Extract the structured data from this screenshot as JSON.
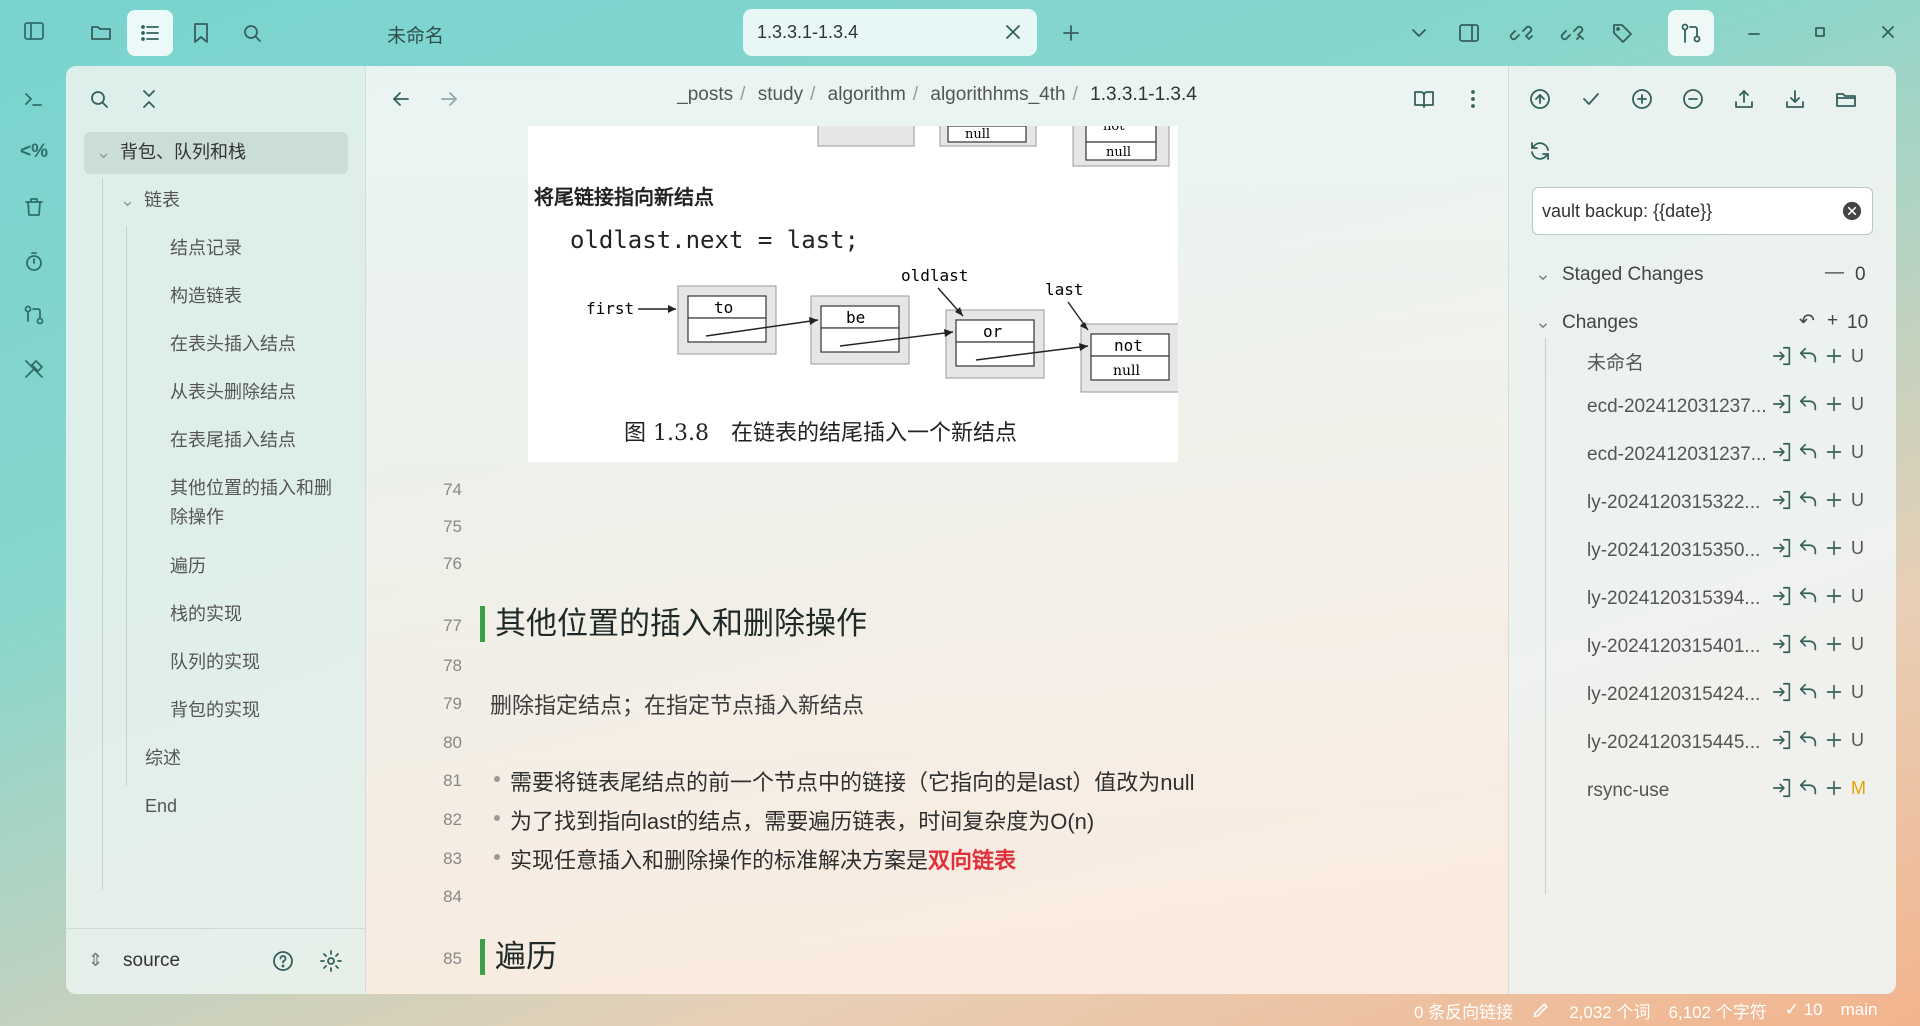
{
  "tabs": {
    "inactive_title": "未命名",
    "active_title": "1.3.3.1-1.3.4"
  },
  "breadcrumb": [
    "_posts",
    "study",
    "algorithm",
    "algorithhms_4th",
    "1.3.3.1-1.3.4"
  ],
  "outline": {
    "root": "背包、队列和栈",
    "group": "链表",
    "items": [
      "结点记录",
      "构造链表",
      "在表头插入结点",
      "从表头删除结点",
      "在表尾插入结点",
      "其他位置的插入和删除操作",
      "遍历",
      "栈的实现",
      "队列的实现",
      "背包的实现"
    ],
    "after": [
      "综述",
      "End"
    ]
  },
  "vault": "source",
  "figure": {
    "subtitle": "将尾链接指向新结点",
    "code": "oldlast.next = last;",
    "labels": {
      "first": "first",
      "oldlast": "oldlast",
      "last": "last"
    },
    "nodes": [
      "to",
      "be",
      "or",
      "not"
    ],
    "null": "null",
    "caption": "图 1.3.8　在链表的结尾插入一个新结点"
  },
  "lines": {
    "n74": "74",
    "n75": "75",
    "n76": "76",
    "n77": "77",
    "n78": "78",
    "n79": "79",
    "n80": "80",
    "n81": "81",
    "n82": "82",
    "n83": "83",
    "n84": "84",
    "n85": "85"
  },
  "content": {
    "h2_1": "其他位置的插入和删除操作",
    "p1": "删除指定结点；在指定节点插入新结点",
    "li1": "需要将链表尾结点的前一个节点中的链接（它指向的是last）值改为null",
    "li2": "为了找到指向last的结点，需要遍历链表，时间复杂度为O(n)",
    "li3_pre": "实现任意插入和删除操作的标准解决方案是",
    "li3_em": "双向链表",
    "h2_2": "遍历"
  },
  "git": {
    "commit_message": "vault backup: {{date}}",
    "staged_label": "Staged Changes",
    "staged_count": "0",
    "changes_label": "Changes",
    "changes_count": "10",
    "files": [
      {
        "name": "未命名",
        "status": "U"
      },
      {
        "name": "ecd-202412031237...",
        "status": "U"
      },
      {
        "name": "ecd-202412031237...",
        "status": "U"
      },
      {
        "name": "ly-2024120315322...",
        "status": "U"
      },
      {
        "name": "ly-2024120315350...",
        "status": "U"
      },
      {
        "name": "ly-2024120315394...",
        "status": "U"
      },
      {
        "name": "ly-2024120315401...",
        "status": "U"
      },
      {
        "name": "ly-2024120315424...",
        "status": "U"
      },
      {
        "name": "ly-2024120315445...",
        "status": "U"
      },
      {
        "name": "rsync-use",
        "status": "M"
      }
    ]
  },
  "statusbar": {
    "backlinks": "0 条反向链接",
    "words": "2,032 个词",
    "chars": "6,102 个字符",
    "sync": "10",
    "branch": "main"
  },
  "colors": {
    "accent_green": "#3aa04a",
    "highlight_red": "#e0303a",
    "modified": "#e6a100"
  }
}
